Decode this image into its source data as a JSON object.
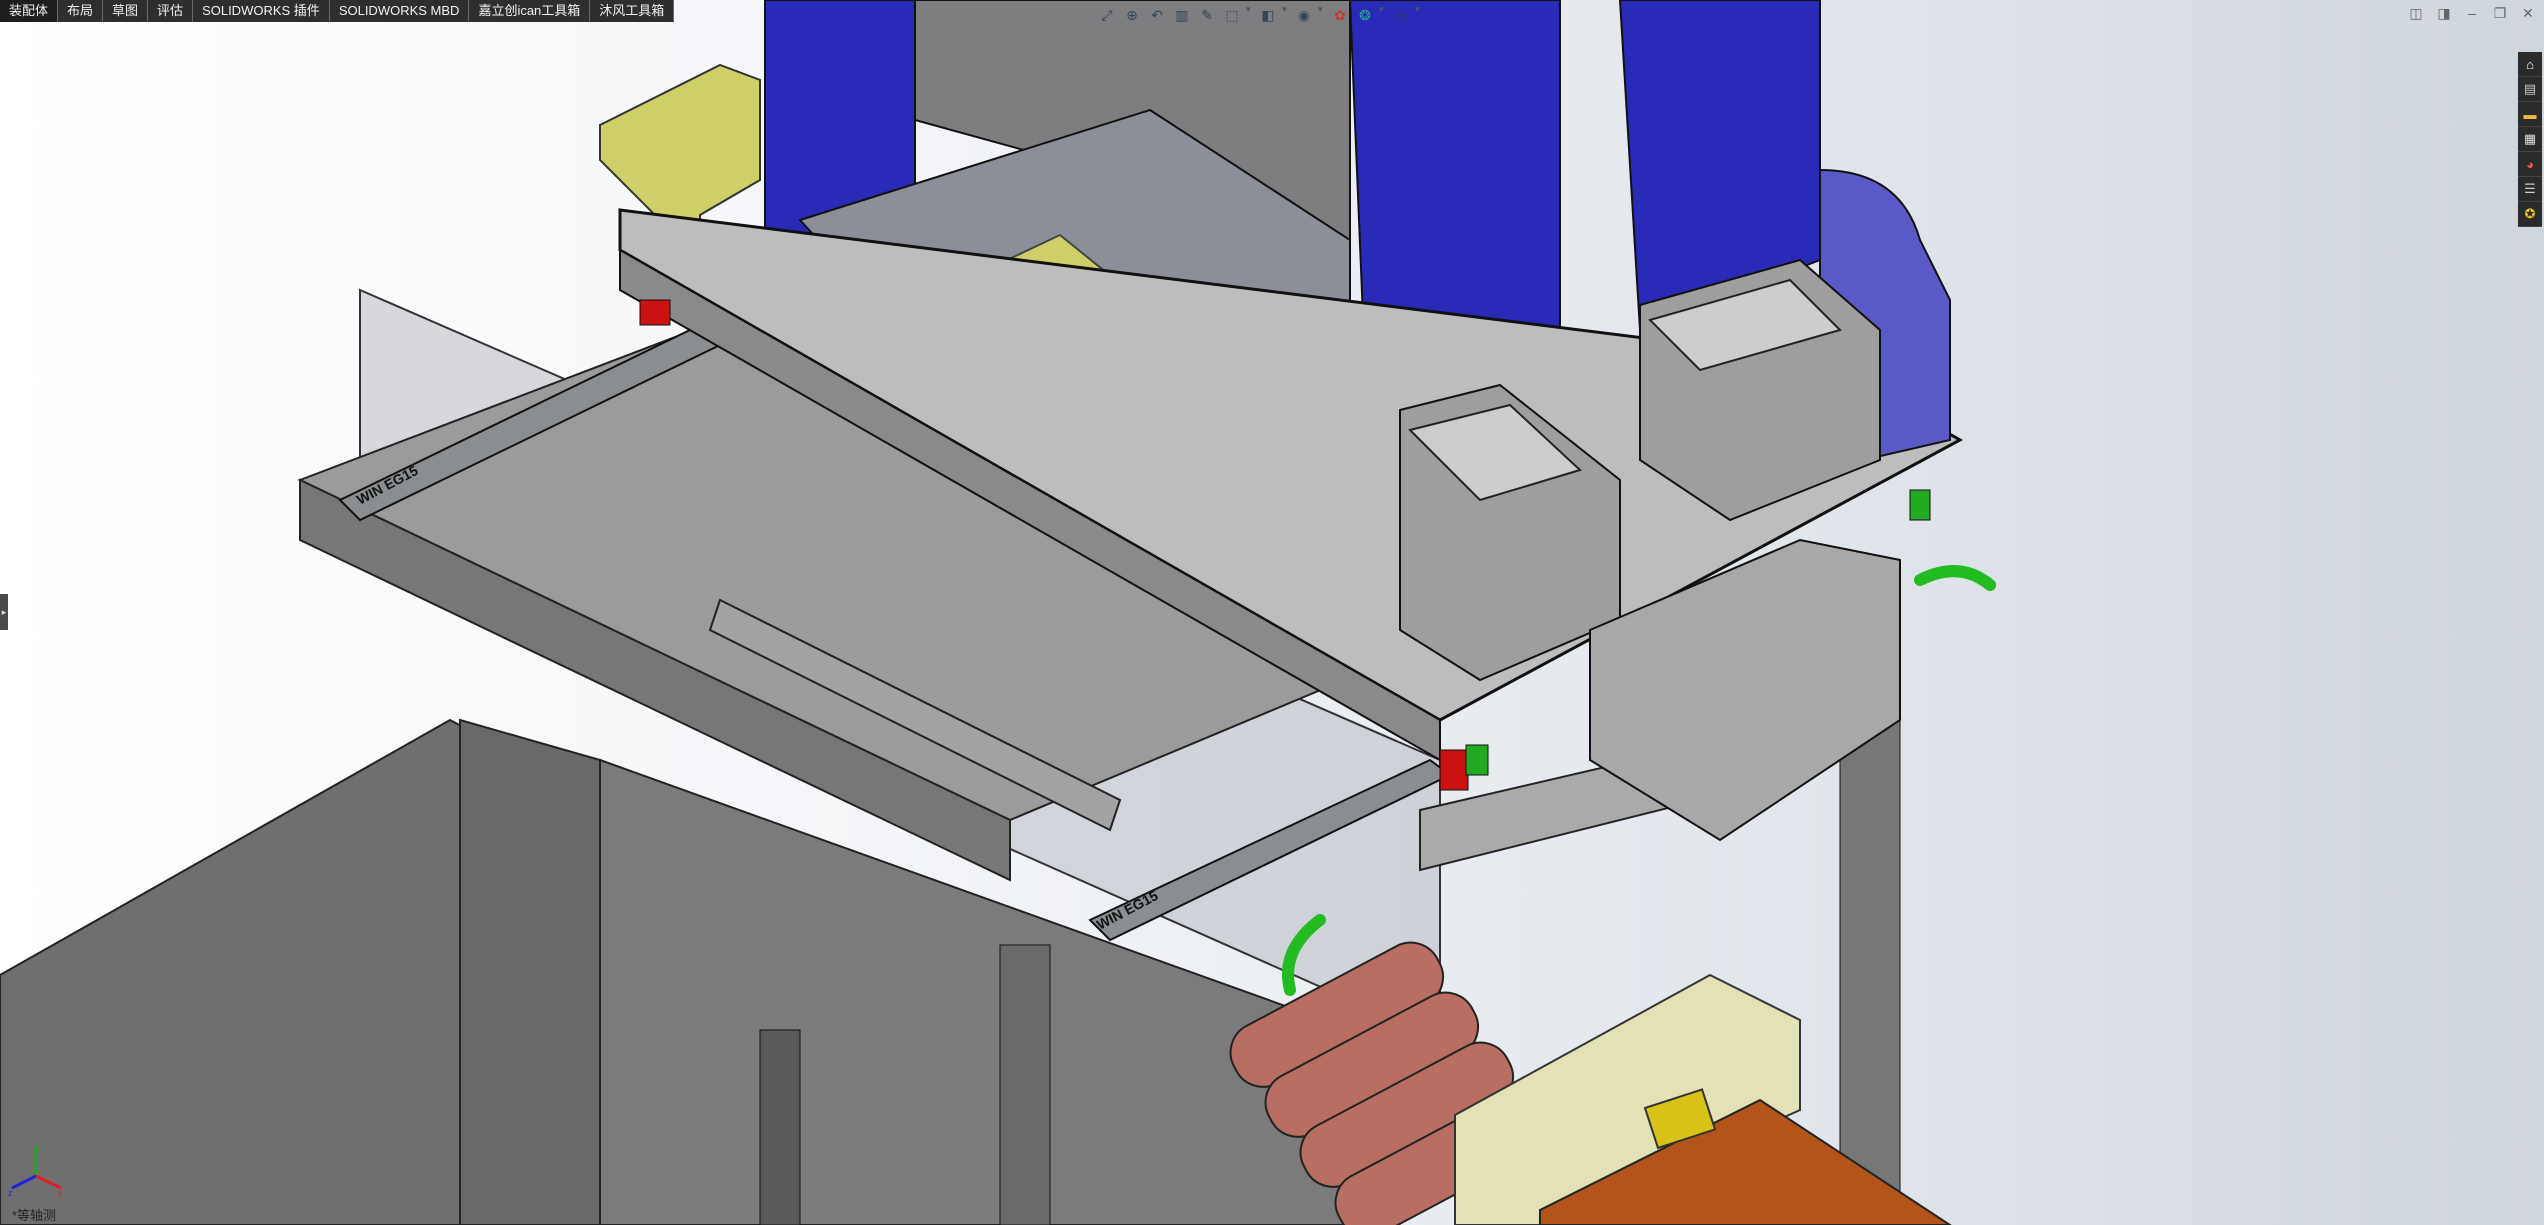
{
  "command_tabs": [
    "装配体",
    "布局",
    "草图",
    "评估",
    "SOLIDWORKS 插件",
    "SOLIDWORKS MBD",
    "嘉立创ican工具箱",
    "沐风工具箱"
  ],
  "heads_up_toolbar": [
    "zoom-to-fit-icon",
    "zoom-area-icon",
    "previous-view-icon",
    "section-view-icon",
    "dynamic-annotation-icon",
    "view-orientation-icon",
    "display-style-icon",
    "hide-show-icon",
    "appearance-icon",
    "scene-icon",
    "monitor-icon"
  ],
  "window_controls": {
    "tile_left": "◫",
    "tile_right": "◨",
    "minimize": "–",
    "restore": "❐",
    "close": "✕"
  },
  "task_pane": [
    "home-icon",
    "design-library-icon",
    "file-explorer-icon",
    "view-palette-icon",
    "appearances-icon",
    "custom-properties-icon",
    "solidworks-forum-icon"
  ],
  "model_labels": {
    "rail_left": "WIN EG15",
    "rail_right": "WIN EG15"
  },
  "view_orientation": "*等轴测",
  "triad_axes": {
    "x": "x",
    "y": "y",
    "z": "z"
  },
  "colors": {
    "blue_plate": "#2a2ab8",
    "yellow_plate": "#cfcf6a",
    "green_hose": "#22bb22",
    "copper_roller": "#b86e62",
    "wood": "#b3541a",
    "red_block": "#cc1111"
  }
}
